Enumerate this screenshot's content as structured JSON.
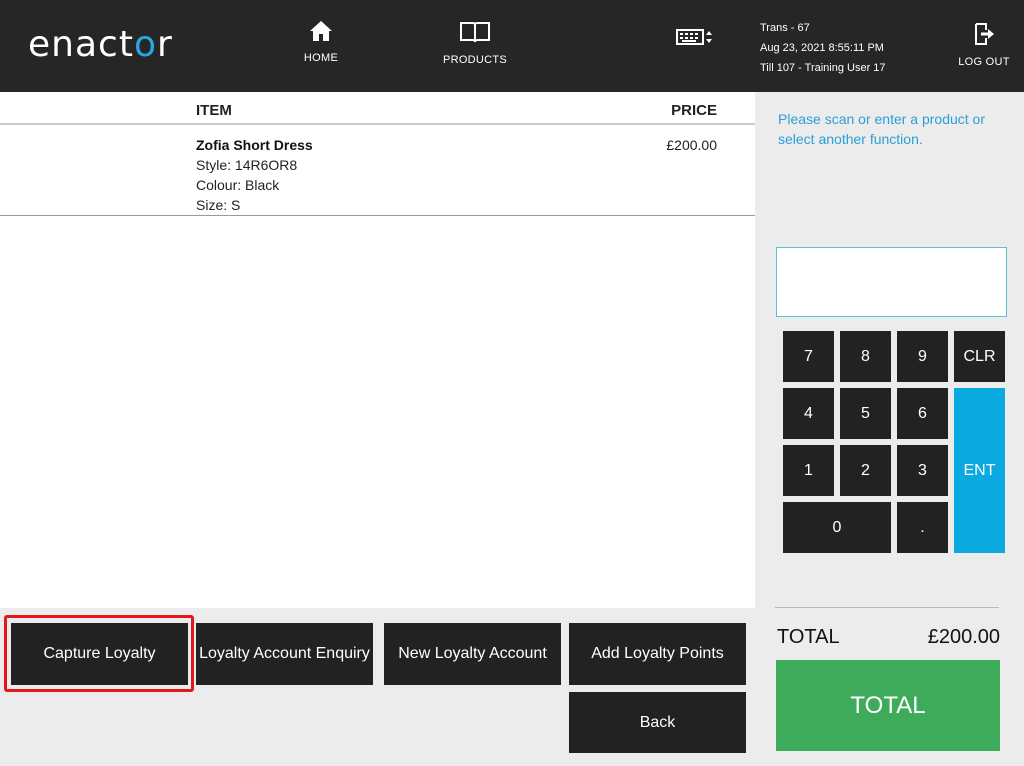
{
  "header": {
    "logo_text_before": "enact",
    "logo_text_o": "o",
    "logo_text_after": "r",
    "nav": {
      "home_label": "HOME",
      "products_label": "PRODUCTS"
    },
    "transaction": {
      "trans": "Trans - 67",
      "datetime": "Aug 23, 2021 8:55:11 PM",
      "till": "Till 107 - Training User 17"
    },
    "logout_label": "LOG OUT"
  },
  "items": {
    "columns": {
      "item": "ITEM",
      "price": "PRICE"
    },
    "rows": [
      {
        "name": "Zofia Short Dress",
        "style": "Style: 14R6OR8",
        "colour": "Colour: Black",
        "size": "Size: S",
        "price": "£200.00"
      }
    ]
  },
  "functions": {
    "capture_loyalty": "Capture Loyalty",
    "loyalty_enquiry": "Loyalty Account Enquiry",
    "new_loyalty": "New Loyalty Account",
    "add_points": "Add Loyalty Points",
    "back": "Back"
  },
  "right_panel": {
    "prompt": "Please scan or enter a product or select another function.",
    "entry_value": "",
    "keypad": {
      "k7": "7",
      "k8": "8",
      "k9": "9",
      "clr": "CLR",
      "k4": "4",
      "k5": "5",
      "k6": "6",
      "ent": "ENT",
      "k1": "1",
      "k2": "2",
      "k3": "3",
      "k0": "0",
      "dot": "."
    },
    "total_label": "TOTAL",
    "total_value": "£200.00",
    "total_button": "TOTAL"
  },
  "colors": {
    "header_bg": "#262626",
    "accent_blue": "#0aa9e0",
    "total_green": "#3dab5a",
    "highlight_red": "#e4171b"
  }
}
